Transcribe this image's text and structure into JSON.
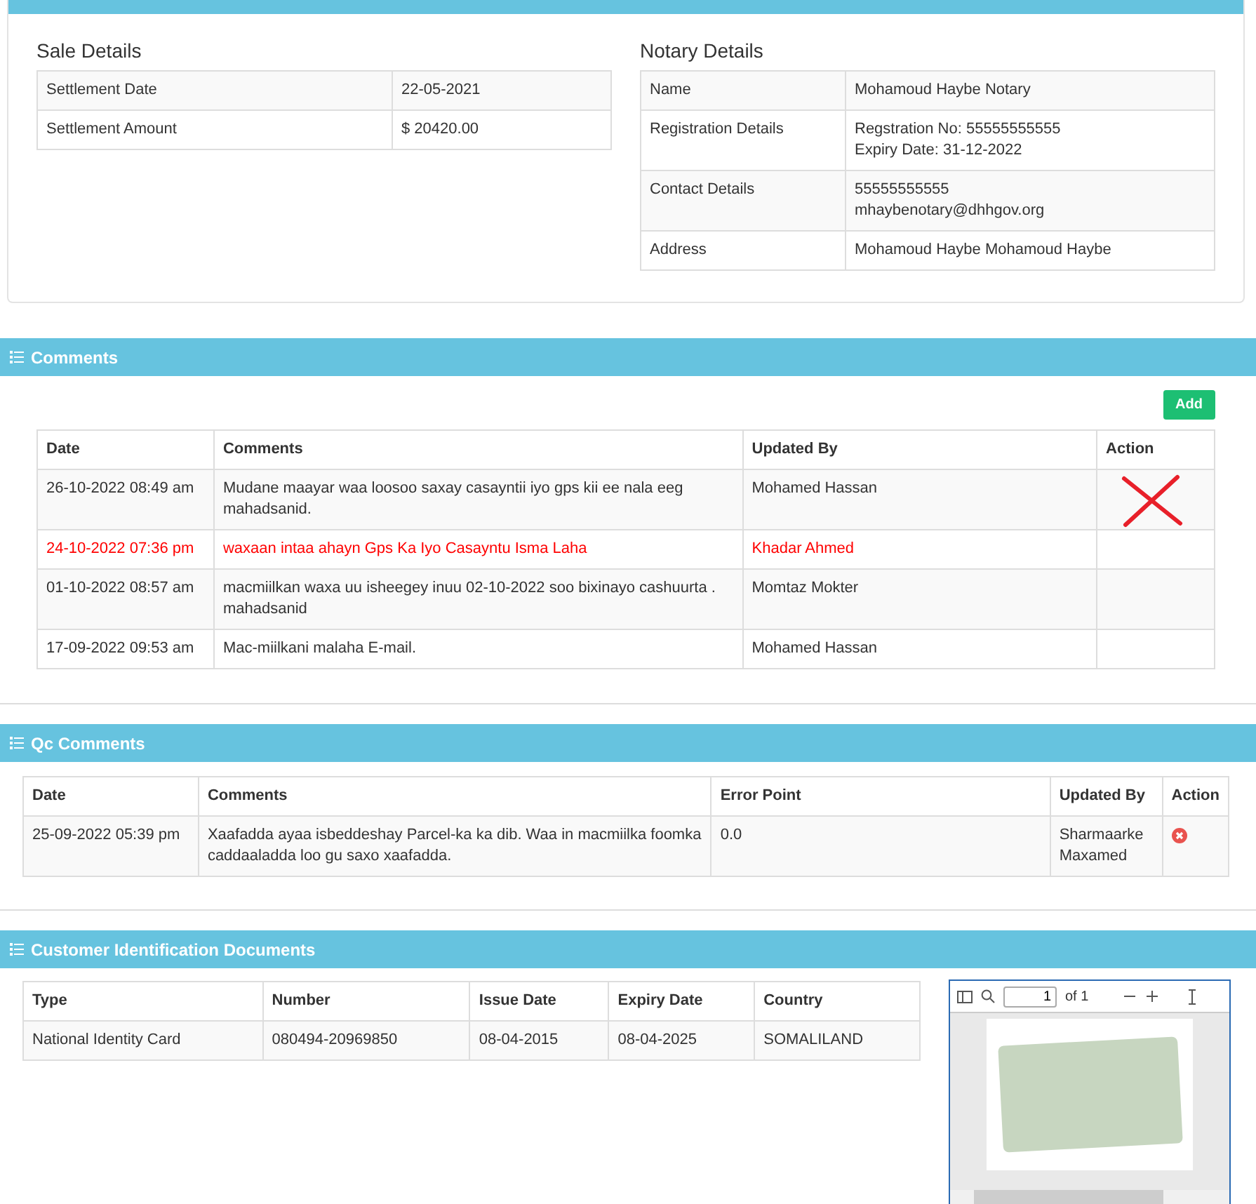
{
  "sale_details": {
    "title": "Sale Details",
    "rows": [
      {
        "label": "Settlement Date",
        "value": "22-05-2021"
      },
      {
        "label": "Settlement Amount",
        "value": "$ 20420.00"
      }
    ]
  },
  "notary_details": {
    "title": "Notary Details",
    "rows": [
      {
        "label": "Name",
        "lines": [
          "Mohamoud Haybe Notary"
        ]
      },
      {
        "label": "Registration Details",
        "lines": [
          "Regstration No: 55555555555",
          "Expiry Date: 31-12-2022"
        ]
      },
      {
        "label": "Contact Details",
        "lines": [
          "55555555555",
          "mhaybenotary@dhhgov.org"
        ]
      },
      {
        "label": "Address",
        "lines": [
          "Mohamoud Haybe Mohamoud Haybe"
        ]
      }
    ]
  },
  "comments": {
    "title": "Comments",
    "add_button": "Add",
    "columns": [
      "Date",
      "Comments",
      "Updated By",
      "Action"
    ],
    "rows": [
      {
        "date": "26-10-2022 08:49 am",
        "comment": "Mudane maayar waa loosoo saxay casayntii iyo gps kii ee nala eeg mahadsanid.",
        "updated_by": "Mohamed Hassan",
        "flagged": false,
        "cross_mark": true
      },
      {
        "date": "24-10-2022 07:36 pm",
        "comment": "waxaan intaa ahayn Gps Ka Iyo Casayntu Isma Laha",
        "updated_by": "Khadar Ahmed",
        "flagged": true,
        "cross_mark": false
      },
      {
        "date": "01-10-2022 08:57 am",
        "comment": "macmiilkan waxa uu isheegey inuu 02-10-2022 soo bixinayo cashuurta . mahadsanid",
        "updated_by": "Momtaz Mokter",
        "flagged": false,
        "cross_mark": false
      },
      {
        "date": "17-09-2022 09:53 am",
        "comment": "Mac-miilkani malaha E-mail.",
        "updated_by": "Mohamed Hassan",
        "flagged": false,
        "cross_mark": false
      }
    ]
  },
  "qc_comments": {
    "title": "Qc Comments",
    "columns": [
      "Date",
      "Comments",
      "Error Point",
      "Updated By",
      "Action"
    ],
    "rows": [
      {
        "date": "25-09-2022 05:39 pm",
        "comment": "Xaafadda ayaa isbeddeshay Parcel-ka ka dib. Waa in macmiilka foomka caddaaladda loo gu saxo xaafadda.",
        "error_point": "0.0",
        "updated_by": "Sharmaarke Maxamed"
      }
    ]
  },
  "identification_documents": {
    "title": "Customer Identification Documents",
    "columns": [
      "Type",
      "Number",
      "Issue Date",
      "Expiry Date",
      "Country"
    ],
    "rows": [
      {
        "type": "National Identity Card",
        "number": "080494-20969850",
        "issue_date": "08-04-2015",
        "expiry_date": "08-04-2025",
        "country": "SOMALILAND"
      }
    ],
    "viewer": {
      "page_value": "1",
      "page_count": "of 1"
    }
  }
}
